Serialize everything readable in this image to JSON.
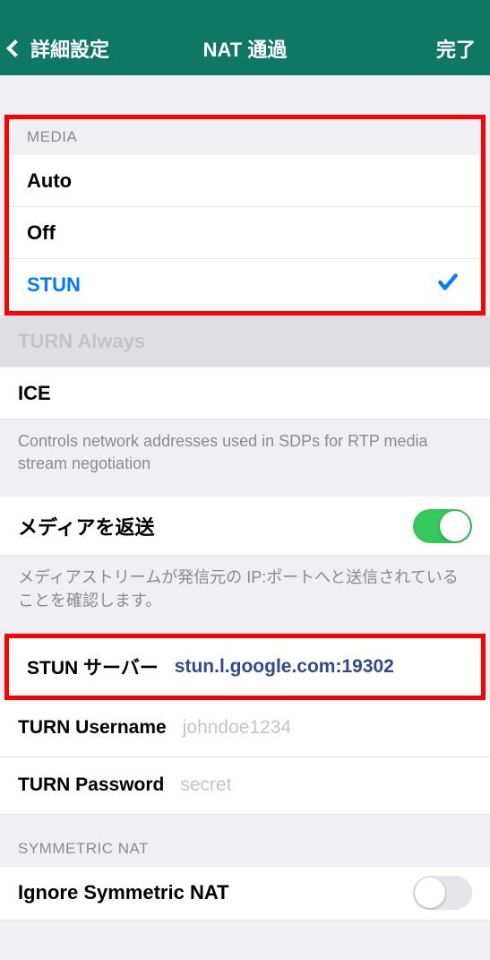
{
  "nav": {
    "back": "詳細設定",
    "title": "NAT 通過",
    "done": "完了"
  },
  "media": {
    "header": "MEDIA",
    "options": {
      "auto": "Auto",
      "off": "Off",
      "stun": "STUN",
      "turn_always": "TURN Always",
      "ice": "ICE"
    },
    "footer": "Controls network addresses used in SDPs for RTP media stream negotiation"
  },
  "reflect": {
    "label": "メディアを返送",
    "footer": "メディアストリームが発信元の IP:ポートへと送信されていることを確認します。"
  },
  "stun_server": {
    "label": "STUN サーバー",
    "value": "stun.l.google.com:19302"
  },
  "turn_user": {
    "label": "TURN Username",
    "placeholder": "johndoe1234"
  },
  "turn_pass": {
    "label": "TURN Password",
    "placeholder": "secret"
  },
  "symmetric": {
    "header": "SYMMETRIC NAT",
    "ignore_label": "Ignore Symmetric NAT"
  }
}
